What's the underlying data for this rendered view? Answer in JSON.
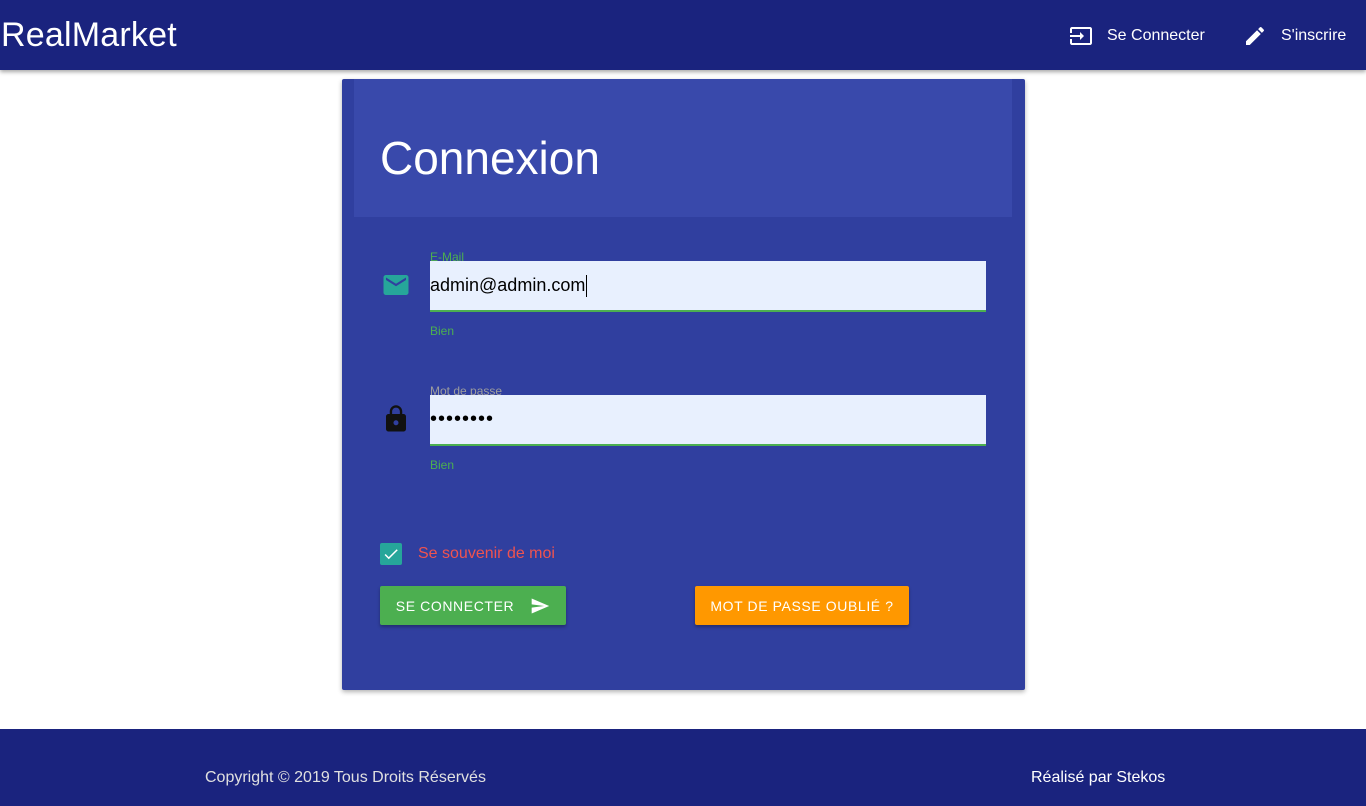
{
  "navbar": {
    "brand": "RealMarket",
    "links": [
      {
        "label": "Se Connecter",
        "icon": "login-icon"
      },
      {
        "label": "S'inscrire",
        "icon": "pencil-icon"
      }
    ]
  },
  "login_card": {
    "title": "Connexion",
    "email": {
      "label": "E-Mail",
      "value": "admin@admin.com",
      "helper": "Bien",
      "icon": "mail-icon"
    },
    "password": {
      "label": "Mot de passe",
      "value": "••••••••",
      "helper": "Bien",
      "icon": "lock-icon"
    },
    "remember_me": {
      "label": "Se souvenir de moi",
      "checked": true
    },
    "submit_label": "Se connecter",
    "forgot_label": "Mot de passe oublié ?"
  },
  "footer": {
    "copyright": "Copyright © 2019 Tous Droits Réservés",
    "credit": "Réalisé par Stekos"
  },
  "colors": {
    "navbar": "#1a237e",
    "card": "#303f9f",
    "card_header": "#3949ab",
    "success": "#4caf50",
    "warning": "#ff9800",
    "teal": "#26a69a",
    "remember_text": "#ef5350"
  }
}
